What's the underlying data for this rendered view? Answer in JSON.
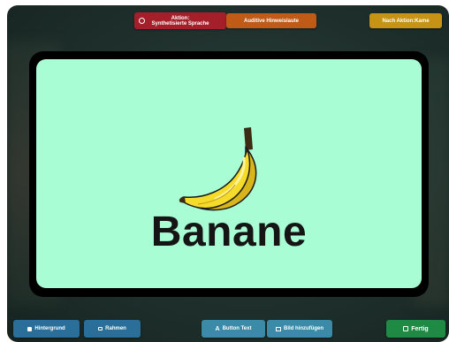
{
  "toolbar_top": {
    "actions_line1": "Aktion:",
    "actions_line2": "Synthetisierte Sprache",
    "audio_label": "Auditive Hinweislaute",
    "back_label": "Nach Aktion:Kame"
  },
  "card": {
    "word": "Banane",
    "image": "banana-image",
    "background_color": "#a9fdd5",
    "border_color": "#000000"
  },
  "toolbar_bottom": {
    "background_label": "Hintergrund",
    "frame_label": "Rahmen",
    "button_text_label": "Button Text",
    "add_image_label": "Bild hinzufügen",
    "done_label": "Fertig"
  },
  "colors": {
    "actions": "#a51f2a",
    "audio": "#c05a17",
    "back": "#c79314",
    "blue": "#2a6f99",
    "teal": "#3a8aa8",
    "done": "#1e8a43"
  }
}
